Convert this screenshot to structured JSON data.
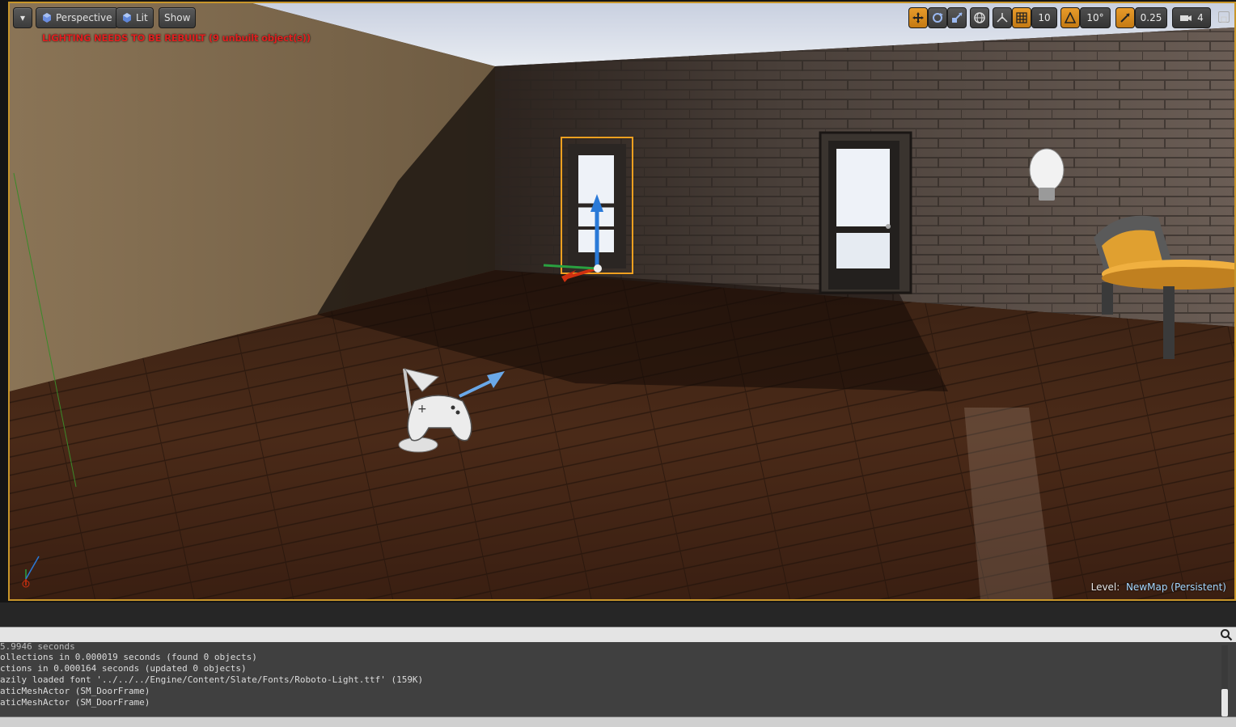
{
  "viewport": {
    "menu_label": "▾",
    "perspective_label": "Perspective",
    "lit_label": "Lit",
    "show_label": "Show",
    "lighting_warning": "LIGHTING NEEDS TO BE REBUILT (9 unbuilt object(s))",
    "level_prefix": "Level:",
    "level_name": "NewMap (Persistent)"
  },
  "right_toolbar": {
    "grid_snap_value": "10",
    "rotation_snap_value": "10°",
    "scale_snap_value": "0.25",
    "camera_speed_value": "4"
  },
  "log": {
    "lines": [
      "5.9946 seconds",
      "ollections in 0.000019 seconds (found 0 objects)",
      "ctions in 0.000164 seconds (updated 0 objects)",
      "azily loaded font '../../../Engine/Content/Slate/Fonts/Roboto-Light.ttf' (159K)",
      "aticMeshActor (SM_DoorFrame)",
      "aticMeshActor (SM_DoorFrame)"
    ]
  },
  "colors": {
    "accent": "#e89b2a",
    "warning": "#e02020",
    "selection_outline": "#c8962a",
    "level_name": "#a6d8ff"
  }
}
